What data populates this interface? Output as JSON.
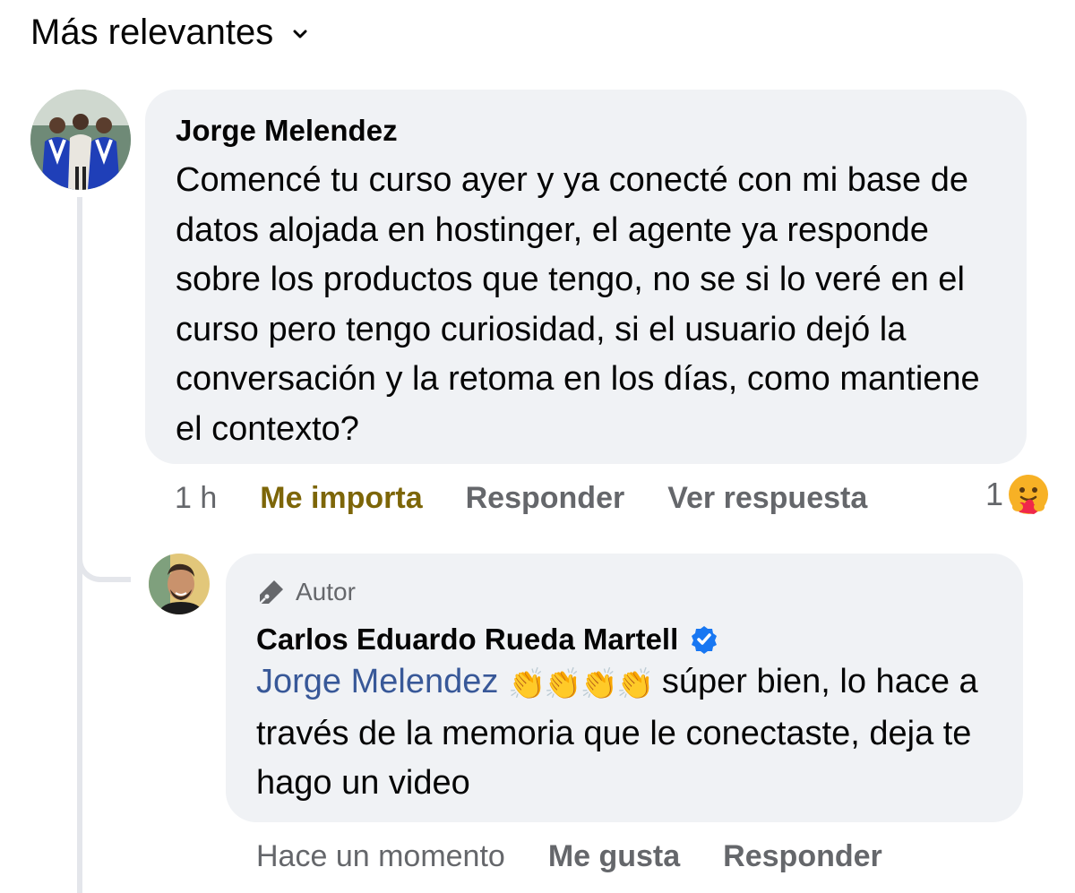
{
  "sort": {
    "label": "Más relevantes",
    "chevron_icon": "chevron-down-icon"
  },
  "comments": [
    {
      "author": "Jorge Melendez",
      "text": "Comencé tu  curso ayer y ya conecté con mi base de datos alojada en hostinger, el agente ya responde sobre los productos que tengo, no se si lo veré en el curso pero tengo curiosidad, si el usuario dejó la conversación y la retoma en los días, como mantiene el contexto?",
      "time": "1 h",
      "reaction_action": "Me importa",
      "reply_action": "Responder",
      "view_replies": "Ver respuesta",
      "reaction_count": "1",
      "reaction_icon": "care-reaction-icon"
    },
    {
      "badge": "Autor",
      "badge_icon": "pen-icon",
      "author": "Carlos Eduardo Rueda Martell",
      "verified_icon": "verified-badge-icon",
      "mention": "Jorge Melendez",
      "emoji": "👏👏👏👏",
      "text": " súper bien, lo hace a través de la memoria que le conectaste, deja te hago un video",
      "time": "Hace un momento",
      "like_action": "Me gusta",
      "reply_action": "Responder"
    }
  ],
  "colors": {
    "bubble": "#f0f2f5",
    "meta_text": "#65676b",
    "mention": "#385898",
    "care_reaction": "#7d6608",
    "verified": "#1877f2"
  }
}
